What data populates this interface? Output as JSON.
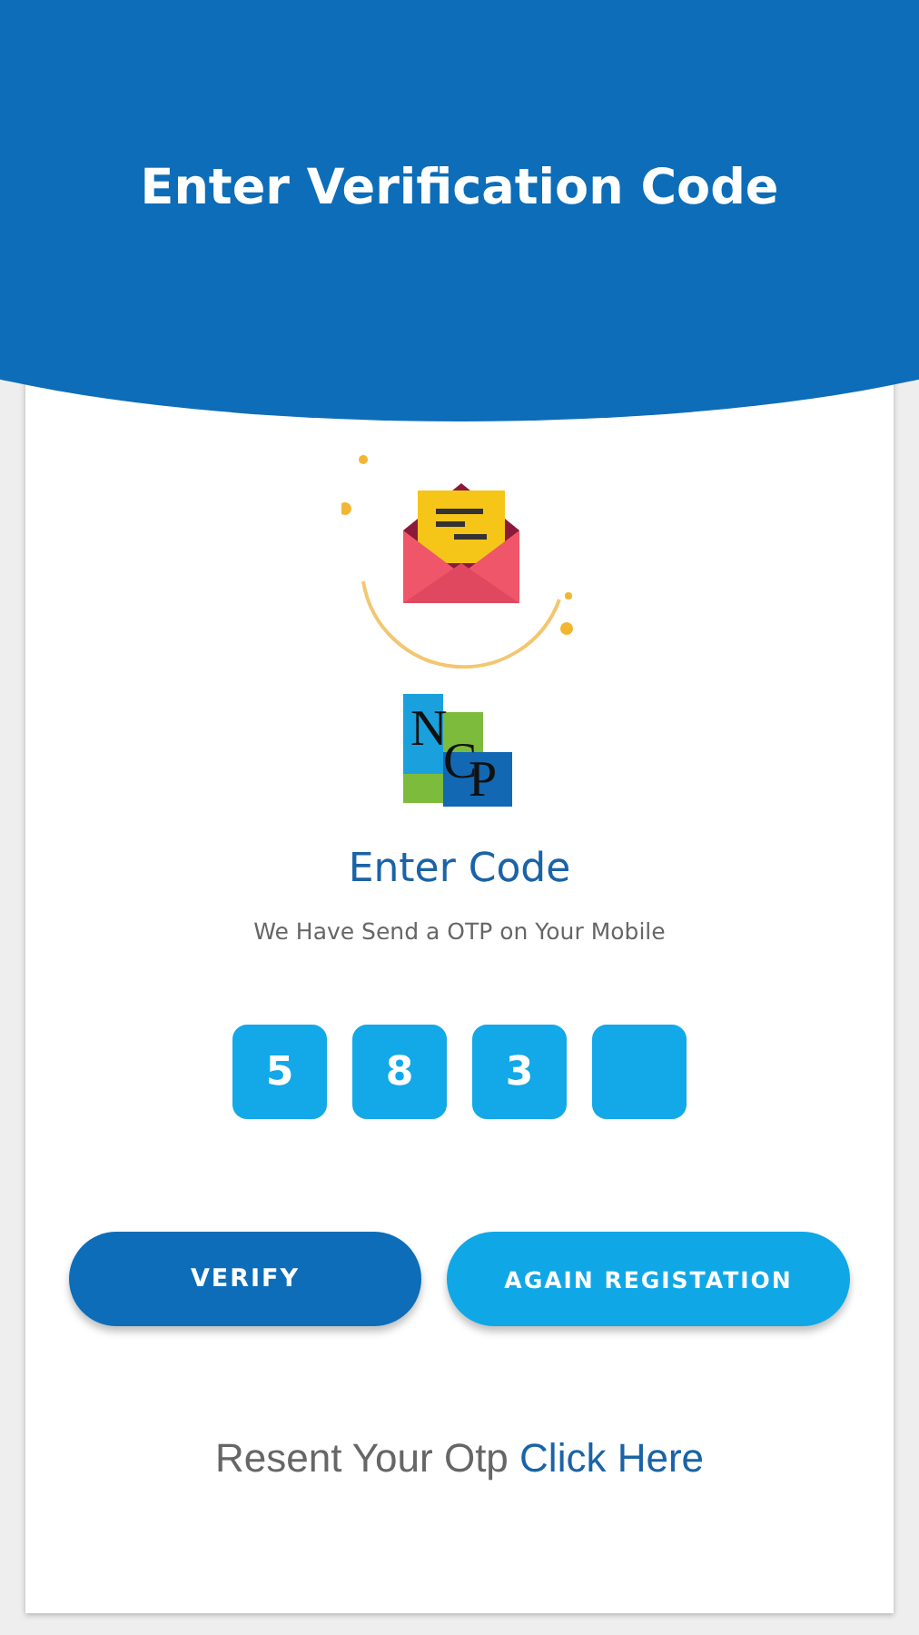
{
  "header": {
    "title": "Enter Verification Code"
  },
  "logo": {
    "letters": [
      "N",
      "C",
      "P"
    ]
  },
  "heading": "Enter Code",
  "subtitle": "We Have Send a OTP on Your Mobile",
  "otp_boxes": [
    {
      "kind": "digit",
      "value": "5"
    },
    {
      "kind": "digit",
      "value": "8"
    },
    {
      "kind": "digit",
      "value": "3"
    },
    {
      "kind": "empty"
    }
  ],
  "buttons": [
    {
      "label": "VERIFY",
      "kind": "primary"
    },
    {
      "label": "AGAIN REGISTATION",
      "kind": "secondary"
    }
  ],
  "resend": {
    "text": "Resent Your Otp",
    "link": "Click Here"
  }
}
